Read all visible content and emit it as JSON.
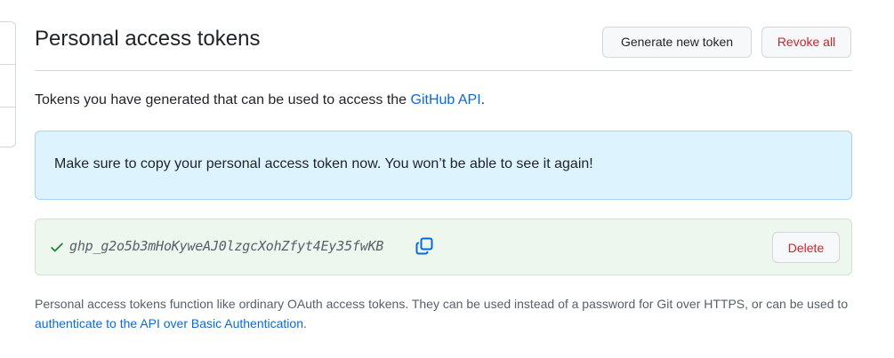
{
  "header": {
    "title": "Personal access tokens",
    "generate_label": "Generate new token",
    "revoke_label": "Revoke all"
  },
  "intro": {
    "text": "Tokens you have generated that can be used to access the ",
    "link": "GitHub API",
    "suffix": "."
  },
  "flash": {
    "message": "Make sure to copy your personal access token now. You won’t be able to see it again!"
  },
  "token": {
    "value": "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",
    "delete_label": "Delete"
  },
  "footer": {
    "text": "Personal access tokens function like ordinary OAuth access tokens. They can be used instead of a password for Git over HTTPS, or can be used to ",
    "link": "authenticate to the API over Basic Authentication",
    "suffix": "."
  },
  "icons": {
    "check": "check-icon",
    "copy": "copy-icon"
  },
  "colors": {
    "link": "#0969da",
    "danger": "#cf222e",
    "success": "#1a7f37",
    "info_bg": "#ddf4ff",
    "token_bg": "#eef7ee"
  }
}
